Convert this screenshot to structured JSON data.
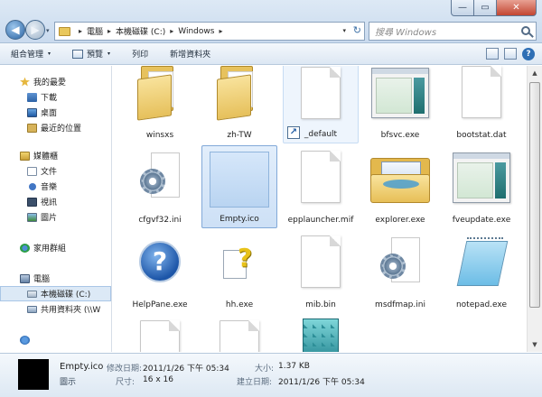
{
  "window": {
    "minimize_glyph": "—",
    "maximize_glyph": "▭",
    "close_glyph": "✕"
  },
  "nav": {
    "back_glyph": "◀",
    "forward_glyph": "▶",
    "dropdown_glyph": "▾"
  },
  "address": {
    "crumbs": [
      "電腦",
      "本機磁碟 (C:)",
      "Windows"
    ],
    "separator": "▸",
    "dropdown_glyph": "▾",
    "refresh_glyph": "↻"
  },
  "search": {
    "placeholder": "搜尋 Windows"
  },
  "toolbar": {
    "organize": "組合管理",
    "preview": "預覽",
    "burn": "列印",
    "new_folder": "新增資料夾",
    "dropdown_glyph": "▾",
    "help_glyph": "?"
  },
  "sidebar": {
    "favorites": "我的最愛",
    "downloads": "下載",
    "desktop": "桌面",
    "recent": "最近的位置",
    "libraries": "媒體櫃",
    "documents": "文件",
    "music": "音樂",
    "videos": "視訊",
    "pictures": "圖片",
    "homegroup": "家用群組",
    "computer": "電腦",
    "local_disk": "本機磁碟 (C:)",
    "shared_folder": "共用資料夾 (\\\\W"
  },
  "files": [
    {
      "name": "winsxs",
      "icon": "folder-icon"
    },
    {
      "name": "zh-TW",
      "icon": "folder-icon"
    },
    {
      "name": "_default",
      "icon": "shortcut-file-icon"
    },
    {
      "name": "bfsvc.exe",
      "icon": "application-icon"
    },
    {
      "name": "bootstat.dat",
      "icon": "blank-file-icon"
    },
    {
      "name": "cfgvf32.ini",
      "icon": "settings-file-icon"
    },
    {
      "name": "Empty.ico",
      "icon": "ico-file-icon"
    },
    {
      "name": "epplauncher.mif",
      "icon": "blank-file-icon"
    },
    {
      "name": "explorer.exe",
      "icon": "explorer-folder-icon"
    },
    {
      "name": "fveupdate.exe",
      "icon": "application-icon"
    },
    {
      "name": "HelpPane.exe",
      "icon": "help-icon"
    },
    {
      "name": "hh.exe",
      "icon": "help-document-icon"
    },
    {
      "name": "mib.bin",
      "icon": "blank-file-icon"
    },
    {
      "name": "msdfmap.ini",
      "icon": "settings-file-icon"
    },
    {
      "name": "notepad.exe",
      "icon": "notepad-icon"
    }
  ],
  "scroll": {
    "up_glyph": "▲",
    "down_glyph": "▼"
  },
  "details": {
    "name": "Empty.ico",
    "type": "圖示",
    "modified_label": "修改日期:",
    "modified_value": "2011/1/26 下午 05:34",
    "size_label": "大小:",
    "size_value": "1.37 KB",
    "dimensions_label": "尺寸:",
    "dimensions_value": "16 x 16",
    "created_label": "建立日期:",
    "created_value": "2011/1/26 下午 05:34"
  }
}
